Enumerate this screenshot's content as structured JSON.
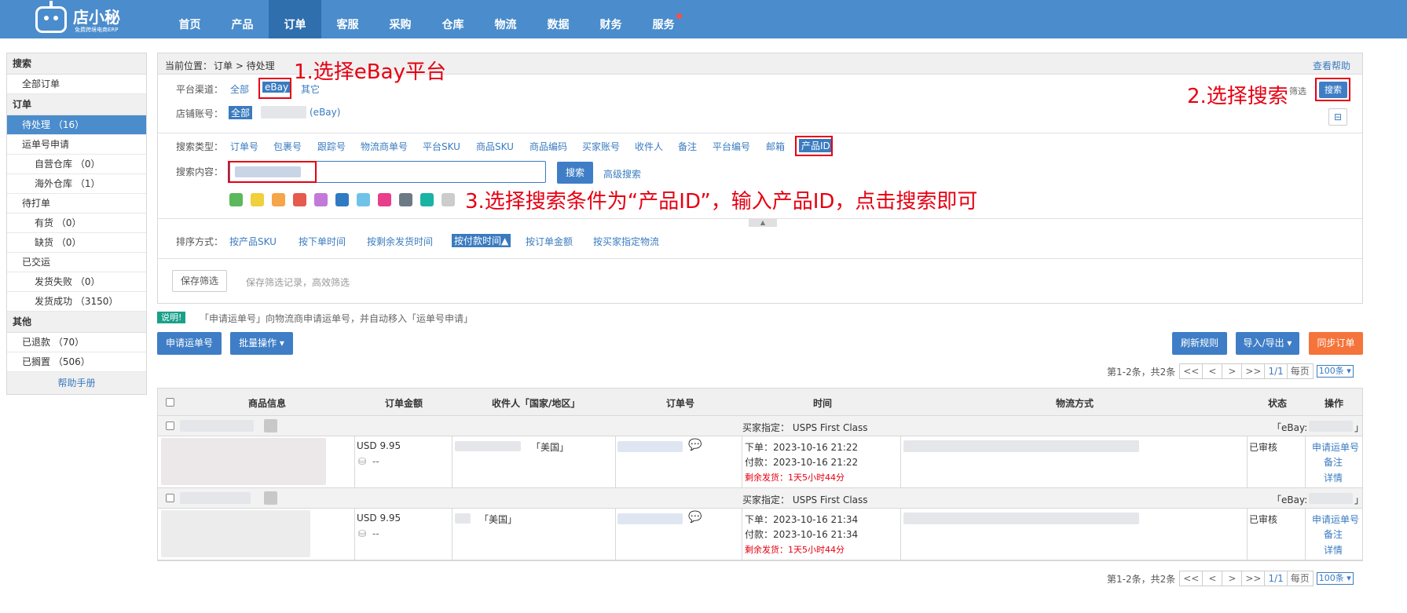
{
  "brand": {
    "name": "店小秘",
    "slogan": "免费跨境电商ERP"
  },
  "nav": [
    "首页",
    "产品",
    "订单",
    "客服",
    "采购",
    "仓库",
    "物流",
    "数据",
    "财务",
    "服务"
  ],
  "nav_active": "订单",
  "sidebar": {
    "sec_search": "搜索",
    "all_orders": "全部订单",
    "sec_orders": "订单",
    "pending": "待处理 （16）",
    "waybill_apply": "运单号申请",
    "own_wh": "自营仓库 （0）",
    "overseas_wh": "海外仓库 （1）",
    "to_print": "待打单",
    "in_stock": "有货 （0）",
    "out_stock": "缺货 （0）",
    "shipped": "已交运",
    "ship_fail": "发货失败 （0）",
    "ship_ok": "发货成功 （3150）",
    "sec_other": "其他",
    "refunded": "已退款 （70）",
    "on_hold": "已搁置 （506）",
    "help": "帮助手册"
  },
  "breadcrumb": {
    "prefix": "当前位置：",
    "path": "订单 > 待处理"
  },
  "help_link": "查看帮助",
  "filter": {
    "platform_label": "平台渠道：",
    "platform_all": "全部",
    "platform_ebay": "eBay",
    "platform_other": "其它",
    "shop_label": "店铺账号：",
    "shop_all": "全部",
    "shop_suffix": "(eBay)",
    "filter_btn": "筛选",
    "search_btn": "搜索",
    "search_type_label": "搜索类型：",
    "search_types": [
      "订单号",
      "包裹号",
      "跟踪号",
      "物流商单号",
      "平台SKU",
      "商品SKU",
      "商品编码",
      "买家账号",
      "收件人",
      "备注",
      "平台编号",
      "邮箱",
      "产品ID"
    ],
    "search_content_label": "搜索内容：",
    "search_button": "搜索",
    "advanced_search": "高级搜索",
    "sort_label": "排序方式：",
    "sorts": [
      "按产品SKU",
      "按下单时间",
      "按剩余发货时间",
      "按付款时间▲",
      "按订单金额",
      "按买家指定物流"
    ],
    "save_filter": "保存筛选",
    "save_hint": "保存筛选记录，高效筛选"
  },
  "annotations": {
    "a1": "1.选择eBay平台",
    "a2": "2.选择搜索",
    "a3": "3.选择搜索条件为“产品ID”，输入产品ID，点击搜索即可"
  },
  "colors": [
    "#5cb85c",
    "#f0d03c",
    "#f5a54a",
    "#e55b4d",
    "#c27ad8",
    "#2f7bc1",
    "#6fc3e8",
    "#e83e8c",
    "#6c7a86",
    "#19b2a3",
    "#cccccc"
  ],
  "notice": {
    "badge": "说明!",
    "text": "「申请运单号」向物流商申请运单号，并自动移入「运单号申请」"
  },
  "actions": {
    "apply_waybill": "申请运单号",
    "batch": "批量操作",
    "refresh_rules": "刷新规则",
    "import_export": "导入/导出",
    "sync": "同步订单"
  },
  "pager": {
    "summary": "第1-2条，共2条",
    "first": "<<",
    "prev": "<",
    "next": ">",
    "last": ">>",
    "page": "1/1",
    "per_label": "每页",
    "per_value": "100条"
  },
  "table": {
    "headers": [
      "商品信息",
      "订单金额",
      "收件人「国家/地区」",
      "订单号",
      "时间",
      "物流方式",
      "状态",
      "操作"
    ],
    "orders": [
      {
        "buyer_logistics": "买家指定： USPS First Class",
        "shop_tag": "「eBay:",
        "shop_end": "」",
        "amount": "USD 9.95",
        "dash": "--",
        "country": "「美国」",
        "order_time": "下单：2023-10-16 21:22",
        "pay_time": "付款：2023-10-16 21:22",
        "remaining": "剩余发货：1天5小时44分",
        "status": "已审核",
        "op1": "申请运单号",
        "op2": "备注",
        "op3": "详情"
      },
      {
        "buyer_logistics": "买家指定： USPS First Class",
        "shop_tag": "「eBay:",
        "shop_end": "」",
        "amount": "USD 9.95",
        "dash": "--",
        "country": "「美国」",
        "order_time": "下单：2023-10-16 21:34",
        "pay_time": "付款：2023-10-16 21:34",
        "remaining": "剩余发货：1天5小时44分",
        "status": "已审核",
        "op1": "申请运单号",
        "op2": "备注",
        "op3": "详情"
      }
    ]
  }
}
